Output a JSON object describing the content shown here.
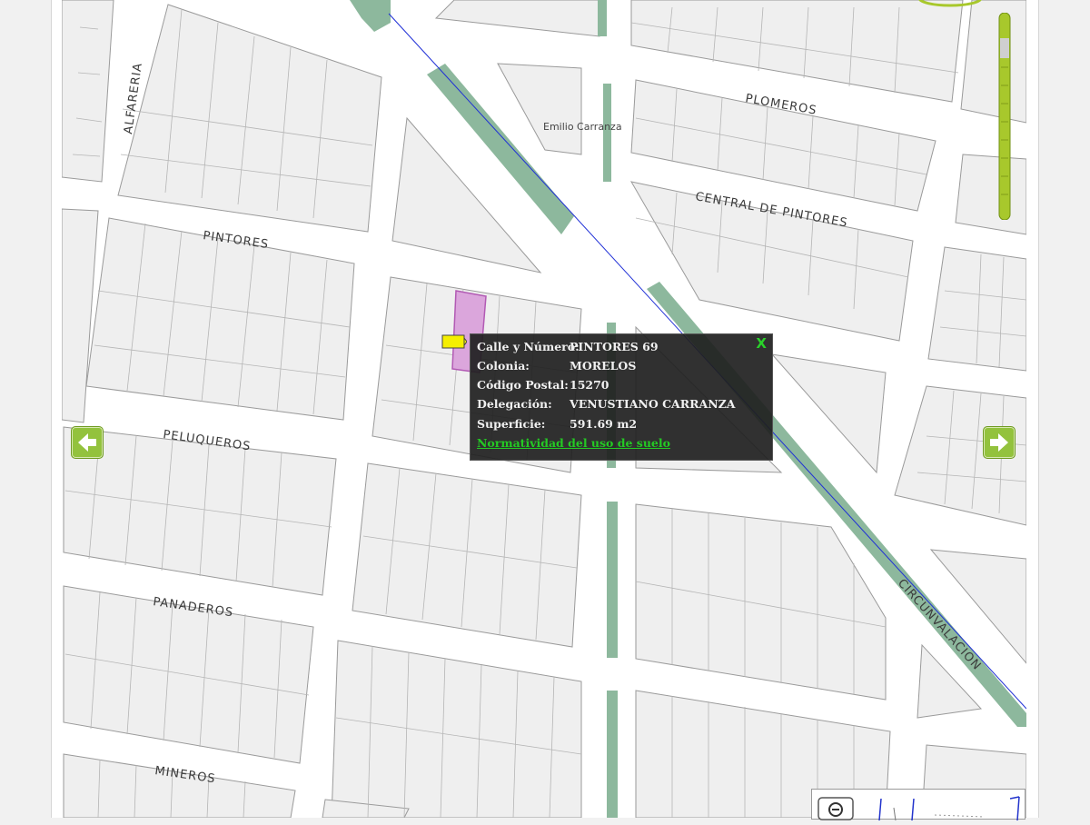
{
  "streets": {
    "alfareria": "ALFARERIA",
    "plomeros": "PLOMEROS",
    "central_de_pintores": "CENTRAL DE PINTORES",
    "pintores": "PINTORES",
    "peluqueros": "PELUQUEROS",
    "panaderos": "PANADEROS",
    "mineros": "MINEROS",
    "circunvalacion": "CIRCUNVALACION"
  },
  "places": {
    "emilio_carranza": "Emilio Carranza"
  },
  "popup": {
    "rows": [
      {
        "label": "Calle y Número:",
        "value": "PINTORES 69"
      },
      {
        "label": "Colonia:",
        "value": "MORELOS"
      },
      {
        "label": "Código Postal:",
        "value": "15270"
      },
      {
        "label": "Delegación:",
        "value": "VENUSTIANO CARRANZA"
      },
      {
        "label": "Superficie:",
        "value": "591.69 m2"
      }
    ],
    "link": "Normatividad del uso de suelo",
    "close": "X"
  },
  "colors": {
    "median": "#8db89d",
    "selected_parcel": "#dba6dc",
    "nav_button": "#93c23d",
    "zoom_bar": "#a8c82c",
    "popup_link": "#24c924",
    "marker": "#f5ef00",
    "route_line": "#1f2fd6"
  },
  "icons": {
    "nav_left": "arrow-left-icon",
    "nav_right": "arrow-right-icon",
    "zoom_out": "zoom-out-icon",
    "marker": "location-marker-icon"
  }
}
